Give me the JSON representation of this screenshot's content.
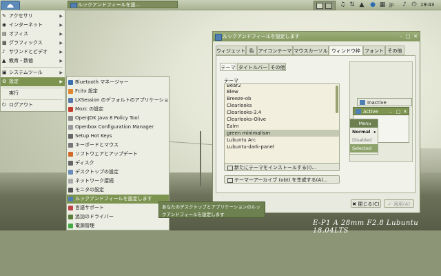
{
  "taskbar": {
    "task_title": "ルックアンドフィールを設...",
    "lang": "jp",
    "clock": "19:43"
  },
  "start_menu": {
    "items": [
      {
        "label": "アクセサリ",
        "icon": "accessories-icon"
      },
      {
        "label": "インターネット",
        "icon": "internet-icon"
      },
      {
        "label": "オフィス",
        "icon": "office-icon"
      },
      {
        "label": "グラフィックス",
        "icon": "graphics-icon"
      },
      {
        "label": "サウンドとビデオ",
        "icon": "sound-video-icon"
      },
      {
        "label": "教育・数値",
        "icon": "education-icon"
      },
      {
        "label": "システムツール",
        "icon": "system-tools-icon"
      },
      {
        "label": "設定",
        "icon": "settings-icon"
      },
      {
        "label": "実行",
        "icon": "run-icon"
      },
      {
        "label": "ログアウト",
        "icon": "logout-icon"
      }
    ]
  },
  "submenu": {
    "items": [
      "Bluetooth マネージャー",
      "Fcitx 設定",
      "LXSession のデフォルトのアプリケーション",
      "Mozc の設定",
      "OpenJDK Java 8 Policy Tool",
      "Openbox Configuration Manager",
      "Setup Hot Keys",
      "キーボードとマウス",
      "ソフトウェアとアップデート",
      "ディスク",
      "デスクトップの設定",
      "ネットワーク接続",
      "モニタの設定",
      "ルックアンドフィールを設定します",
      "言語サポート",
      "追加のドライバー",
      "電源管理"
    ],
    "tooltip": "あなたのデスクトップとアプリケーションのルックアンドフィールを設定します"
  },
  "window": {
    "title": "ルックアンドフィールを設定します",
    "tabs": [
      "ウィジェット",
      "色",
      "アイコンテーマ",
      "マウスカーソル",
      "ウィンドウ枠",
      "フォント",
      "その他"
    ],
    "subtabs": [
      "テーマ",
      "タイトルバー",
      "その他"
    ],
    "theme_label": "テーマ",
    "themes": [
      "Bear2",
      "Blew",
      "Breeze-ob",
      "Clearlooks",
      "Clearlooks-3.4",
      "Clearlooks-Olive",
      "Ealm",
      "green minimalism",
      "Lubuntu Arc",
      "Lubuntu-dark-panel"
    ],
    "selected_theme": "green minimalism",
    "install_button": "新たにテーマをインストールする(I)...",
    "archive_button": "テーマーアーカイブ (obt) を生成する(A)...",
    "close_button": "閉じる(C)",
    "apply_button": "適用(A)"
  },
  "preview": {
    "inactive": "Inactive",
    "active": "Active",
    "menu": "Menu",
    "normal": "Normal",
    "disabled": "Disabled",
    "selected": "Selected"
  },
  "watermark": "E-P1 A 28mm F2.8  Lubuntu 18.04LTS"
}
